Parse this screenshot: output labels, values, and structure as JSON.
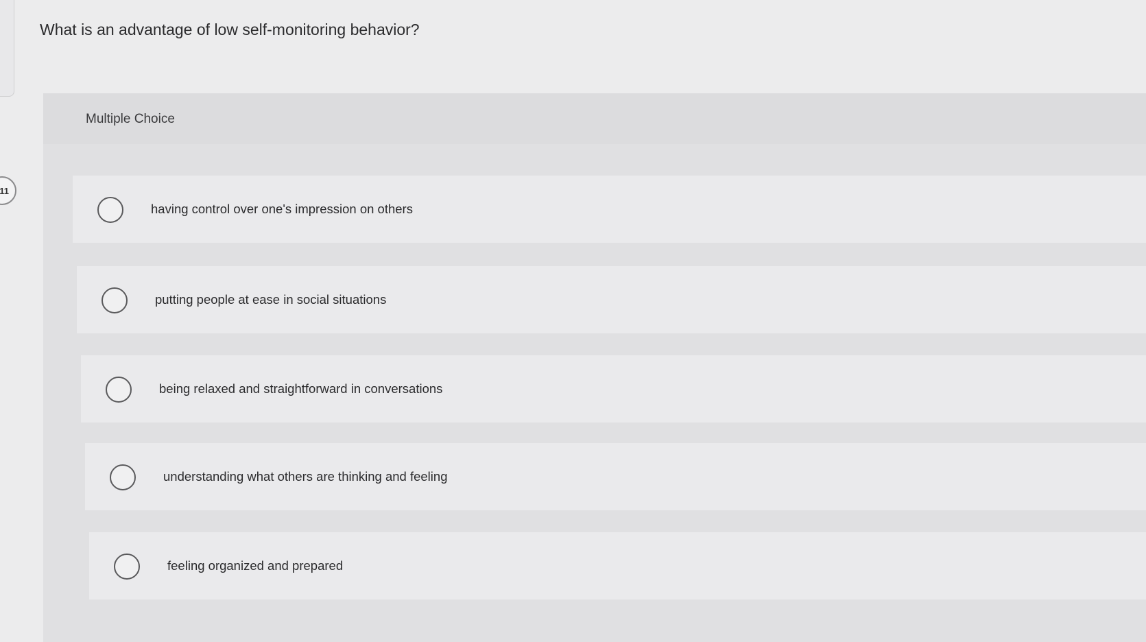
{
  "question": {
    "number": "11",
    "text": "What is an advantage of low self-monitoring behavior?",
    "type_label": "Multiple Choice"
  },
  "options": [
    {
      "label": "having control over one's impression on others",
      "selected": false
    },
    {
      "label": "putting people at ease in social situations",
      "selected": false
    },
    {
      "label": "being relaxed and straightforward in conversations",
      "selected": false
    },
    {
      "label": "understanding what others are thinking and feeling",
      "selected": false
    },
    {
      "label": "feeling organized and prepared",
      "selected": false
    }
  ],
  "icons": {
    "radio": "radio-circle-icon"
  }
}
